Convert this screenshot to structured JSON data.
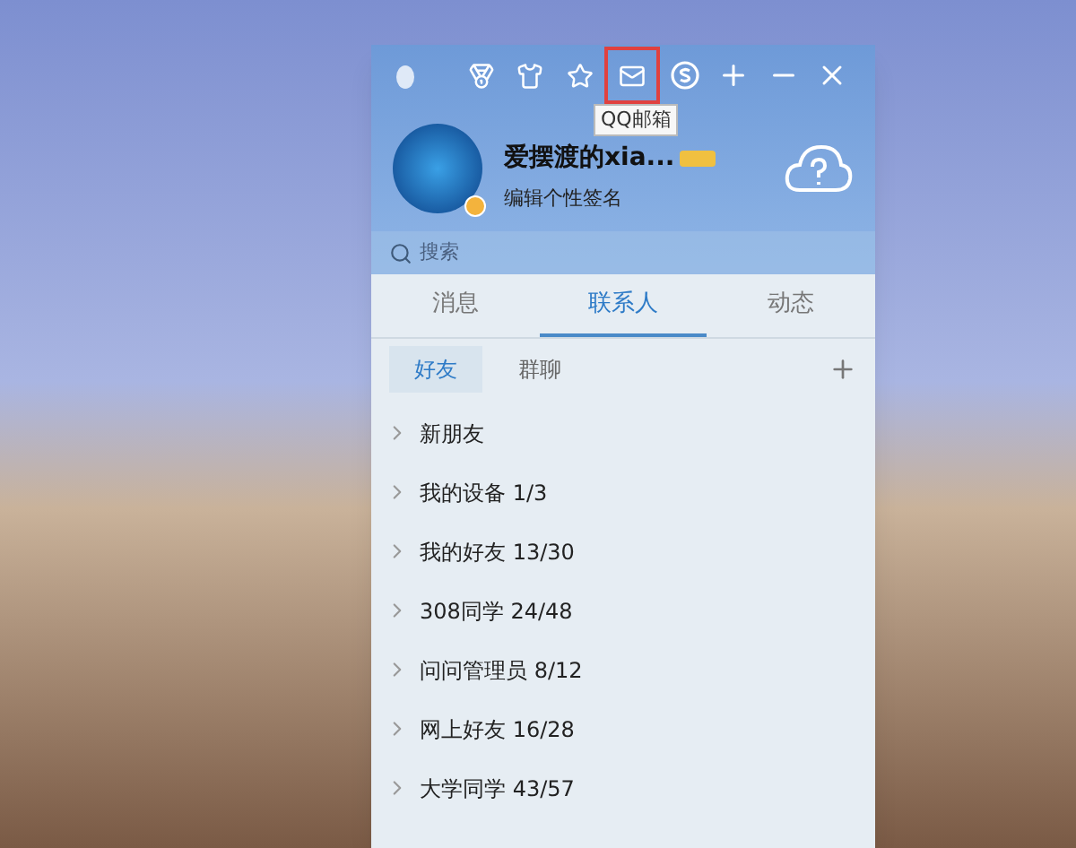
{
  "toolbar": [
    {
      "kind": "penguin",
      "highlighted": false
    },
    {
      "kind": "medal",
      "highlighted": false
    },
    {
      "kind": "shirt",
      "highlighted": false
    },
    {
      "kind": "star",
      "highlighted": false
    },
    {
      "kind": "mail",
      "highlighted": true
    },
    {
      "kind": "s-circle",
      "highlighted": false
    },
    {
      "kind": "plus",
      "highlighted": false
    },
    {
      "kind": "minimize",
      "highlighted": false
    },
    {
      "kind": "close",
      "highlighted": false
    }
  ],
  "tooltip": "QQ邮箱",
  "profile": {
    "nickname": "爱摆渡的xia...",
    "signature": "编辑个性签名"
  },
  "search": {
    "placeholder": "搜索"
  },
  "tabs": [
    {
      "label": "消息",
      "selected": false
    },
    {
      "label": "联系人",
      "selected": true
    },
    {
      "label": "动态",
      "selected": false
    }
  ],
  "subtabs": [
    {
      "label": "好友",
      "selected": true
    },
    {
      "label": "群聊",
      "selected": false
    }
  ],
  "groups": [
    {
      "name": "新朋友",
      "expanded": false
    },
    {
      "name": "我的设备",
      "count": "1/3",
      "expanded": false
    },
    {
      "name": "我的好友",
      "count": "13/30",
      "expanded": false
    },
    {
      "name": "308同学",
      "count": "24/48",
      "expanded": false
    },
    {
      "name": "问问管理员",
      "count": "8/12",
      "expanded": false
    },
    {
      "name": "网上好友",
      "count": "16/28",
      "expanded": false
    },
    {
      "name": "大学同学",
      "count": "43/57",
      "expanded": false
    }
  ]
}
